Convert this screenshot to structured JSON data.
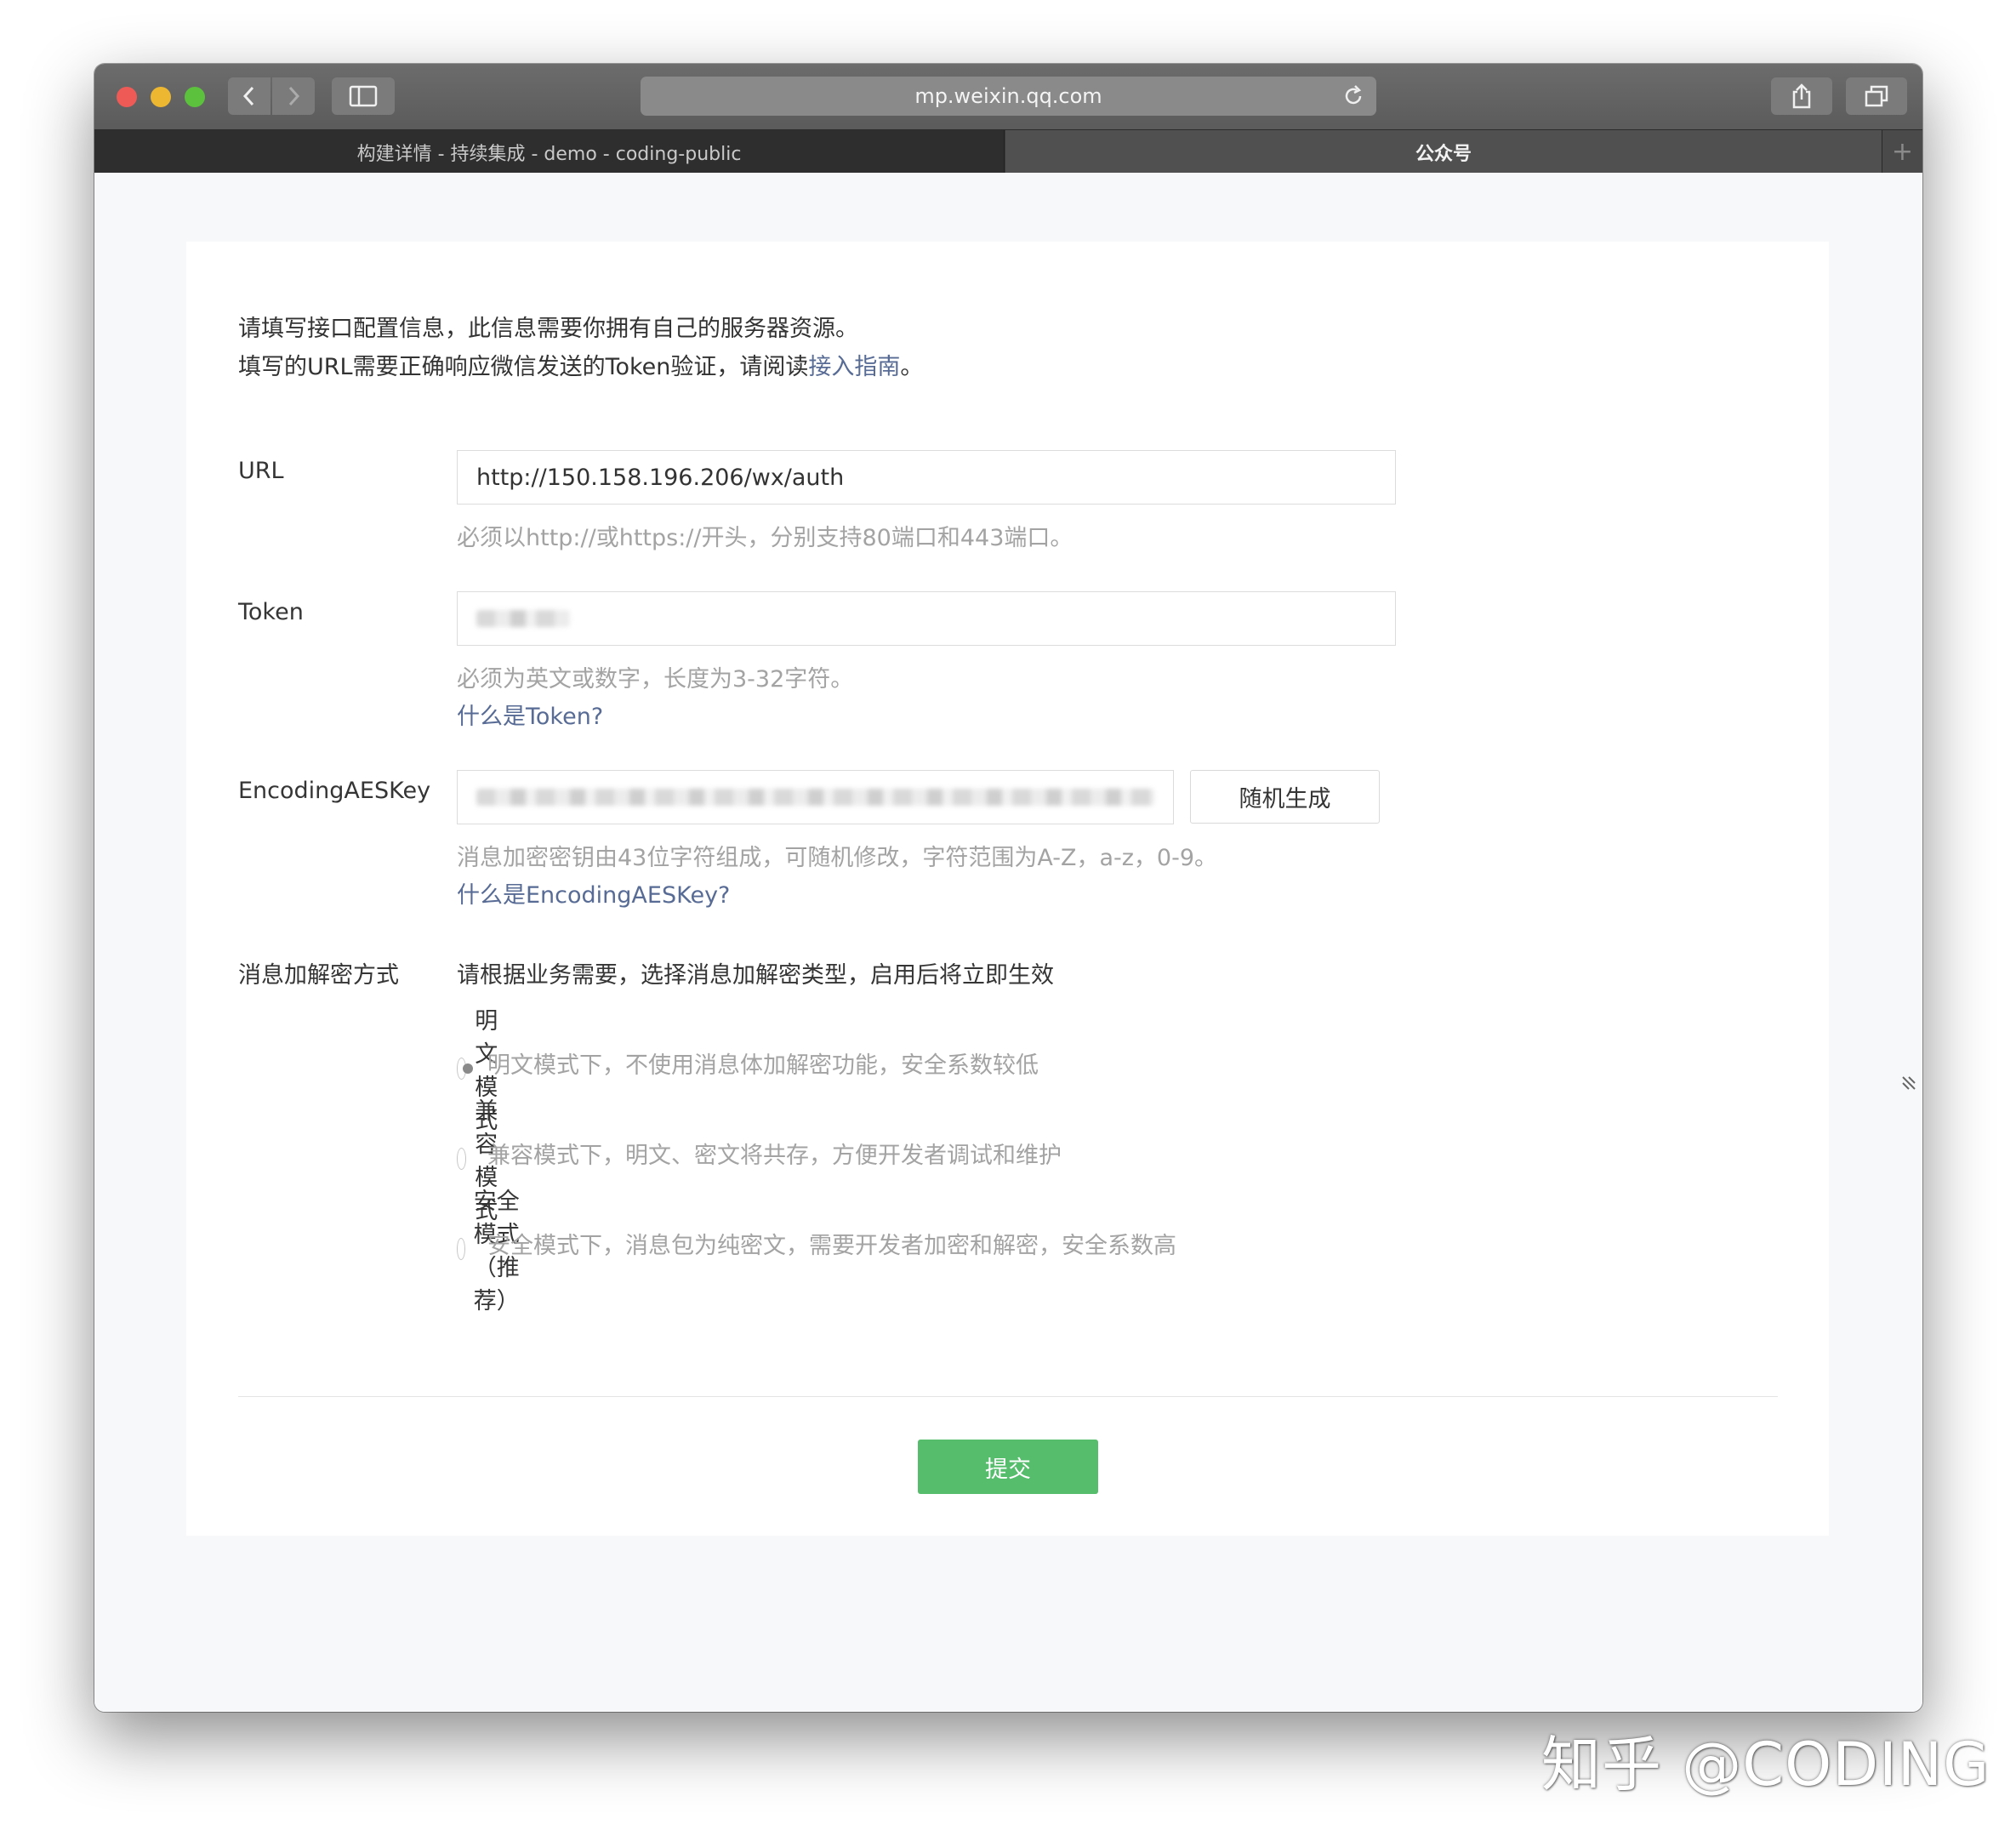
{
  "browser": {
    "url": "mp.weixin.qq.com",
    "tabs": [
      {
        "label": "构建详情 - 持续集成 - demo - coding-public",
        "active": false
      },
      {
        "label": "公众号",
        "active": true
      }
    ],
    "new_tab_label": "+"
  },
  "page": {
    "intro_line1": "请填写接口配置信息，此信息需要你拥有自己的服务器资源。",
    "intro_line2_prefix": "填写的URL需要正确响应微信发送的Token验证，请阅读",
    "intro_line2_link": "接入指南",
    "intro_line2_suffix": "。",
    "url": {
      "label": "URL",
      "value": "http://150.158.196.206/wx/auth",
      "hint": "必须以http://或https://开头，分别支持80端口和443端口。"
    },
    "token": {
      "label": "Token",
      "hint": "必须为英文或数字，长度为3-32字符。",
      "link": "什么是Token?"
    },
    "aes": {
      "label": "EncodingAESKey",
      "random_button": "随机生成",
      "hint": "消息加密密钥由43位字符组成，可随机修改，字符范围为A-Z，a-z，0-9。",
      "link": "什么是EncodingAESKey?"
    },
    "encryption": {
      "label": "消息加解密方式",
      "description": "请根据业务需要，选择消息加解密类型，启用后将立即生效",
      "options": [
        {
          "label": "明文模式",
          "hint": "明文模式下，不使用消息体加解密功能，安全系数较低",
          "checked": true
        },
        {
          "label": "兼容模式",
          "hint": "兼容模式下，明文、密文将共存，方便开发者调试和维护",
          "checked": false
        },
        {
          "label": "安全模式（推荐）",
          "hint": "安全模式下，消息包为纯密文，需要开发者加密和解密，安全系数高",
          "checked": false
        }
      ]
    },
    "submit_label": "提交"
  },
  "watermark": "知乎 @CODING",
  "colors": {
    "primary_button": "#56bd6d",
    "link": "#576b95",
    "hint_text": "#a3a3a3"
  }
}
